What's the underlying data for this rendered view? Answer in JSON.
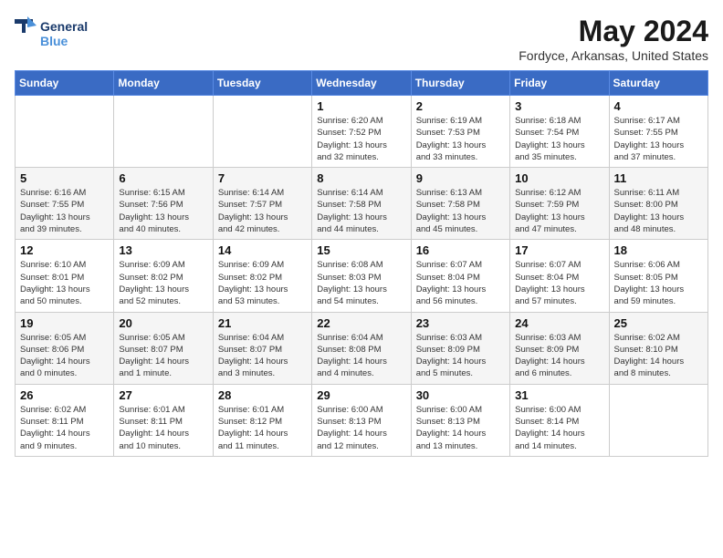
{
  "logo": {
    "line1": "General",
    "line2": "Blue"
  },
  "title": "May 2024",
  "location": "Fordyce, Arkansas, United States",
  "weekdays": [
    "Sunday",
    "Monday",
    "Tuesday",
    "Wednesday",
    "Thursday",
    "Friday",
    "Saturday"
  ],
  "weeks": [
    [
      {
        "day": "",
        "info": ""
      },
      {
        "day": "",
        "info": ""
      },
      {
        "day": "",
        "info": ""
      },
      {
        "day": "1",
        "info": "Sunrise: 6:20 AM\nSunset: 7:52 PM\nDaylight: 13 hours\nand 32 minutes."
      },
      {
        "day": "2",
        "info": "Sunrise: 6:19 AM\nSunset: 7:53 PM\nDaylight: 13 hours\nand 33 minutes."
      },
      {
        "day": "3",
        "info": "Sunrise: 6:18 AM\nSunset: 7:54 PM\nDaylight: 13 hours\nand 35 minutes."
      },
      {
        "day": "4",
        "info": "Sunrise: 6:17 AM\nSunset: 7:55 PM\nDaylight: 13 hours\nand 37 minutes."
      }
    ],
    [
      {
        "day": "5",
        "info": "Sunrise: 6:16 AM\nSunset: 7:55 PM\nDaylight: 13 hours\nand 39 minutes."
      },
      {
        "day": "6",
        "info": "Sunrise: 6:15 AM\nSunset: 7:56 PM\nDaylight: 13 hours\nand 40 minutes."
      },
      {
        "day": "7",
        "info": "Sunrise: 6:14 AM\nSunset: 7:57 PM\nDaylight: 13 hours\nand 42 minutes."
      },
      {
        "day": "8",
        "info": "Sunrise: 6:14 AM\nSunset: 7:58 PM\nDaylight: 13 hours\nand 44 minutes."
      },
      {
        "day": "9",
        "info": "Sunrise: 6:13 AM\nSunset: 7:58 PM\nDaylight: 13 hours\nand 45 minutes."
      },
      {
        "day": "10",
        "info": "Sunrise: 6:12 AM\nSunset: 7:59 PM\nDaylight: 13 hours\nand 47 minutes."
      },
      {
        "day": "11",
        "info": "Sunrise: 6:11 AM\nSunset: 8:00 PM\nDaylight: 13 hours\nand 48 minutes."
      }
    ],
    [
      {
        "day": "12",
        "info": "Sunrise: 6:10 AM\nSunset: 8:01 PM\nDaylight: 13 hours\nand 50 minutes."
      },
      {
        "day": "13",
        "info": "Sunrise: 6:09 AM\nSunset: 8:02 PM\nDaylight: 13 hours\nand 52 minutes."
      },
      {
        "day": "14",
        "info": "Sunrise: 6:09 AM\nSunset: 8:02 PM\nDaylight: 13 hours\nand 53 minutes."
      },
      {
        "day": "15",
        "info": "Sunrise: 6:08 AM\nSunset: 8:03 PM\nDaylight: 13 hours\nand 54 minutes."
      },
      {
        "day": "16",
        "info": "Sunrise: 6:07 AM\nSunset: 8:04 PM\nDaylight: 13 hours\nand 56 minutes."
      },
      {
        "day": "17",
        "info": "Sunrise: 6:07 AM\nSunset: 8:04 PM\nDaylight: 13 hours\nand 57 minutes."
      },
      {
        "day": "18",
        "info": "Sunrise: 6:06 AM\nSunset: 8:05 PM\nDaylight: 13 hours\nand 59 minutes."
      }
    ],
    [
      {
        "day": "19",
        "info": "Sunrise: 6:05 AM\nSunset: 8:06 PM\nDaylight: 14 hours\nand 0 minutes."
      },
      {
        "day": "20",
        "info": "Sunrise: 6:05 AM\nSunset: 8:07 PM\nDaylight: 14 hours\nand 1 minute."
      },
      {
        "day": "21",
        "info": "Sunrise: 6:04 AM\nSunset: 8:07 PM\nDaylight: 14 hours\nand 3 minutes."
      },
      {
        "day": "22",
        "info": "Sunrise: 6:04 AM\nSunset: 8:08 PM\nDaylight: 14 hours\nand 4 minutes."
      },
      {
        "day": "23",
        "info": "Sunrise: 6:03 AM\nSunset: 8:09 PM\nDaylight: 14 hours\nand 5 minutes."
      },
      {
        "day": "24",
        "info": "Sunrise: 6:03 AM\nSunset: 8:09 PM\nDaylight: 14 hours\nand 6 minutes."
      },
      {
        "day": "25",
        "info": "Sunrise: 6:02 AM\nSunset: 8:10 PM\nDaylight: 14 hours\nand 8 minutes."
      }
    ],
    [
      {
        "day": "26",
        "info": "Sunrise: 6:02 AM\nSunset: 8:11 PM\nDaylight: 14 hours\nand 9 minutes."
      },
      {
        "day": "27",
        "info": "Sunrise: 6:01 AM\nSunset: 8:11 PM\nDaylight: 14 hours\nand 10 minutes."
      },
      {
        "day": "28",
        "info": "Sunrise: 6:01 AM\nSunset: 8:12 PM\nDaylight: 14 hours\nand 11 minutes."
      },
      {
        "day": "29",
        "info": "Sunrise: 6:00 AM\nSunset: 8:13 PM\nDaylight: 14 hours\nand 12 minutes."
      },
      {
        "day": "30",
        "info": "Sunrise: 6:00 AM\nSunset: 8:13 PM\nDaylight: 14 hours\nand 13 minutes."
      },
      {
        "day": "31",
        "info": "Sunrise: 6:00 AM\nSunset: 8:14 PM\nDaylight: 14 hours\nand 14 minutes."
      },
      {
        "day": "",
        "info": ""
      }
    ]
  ]
}
